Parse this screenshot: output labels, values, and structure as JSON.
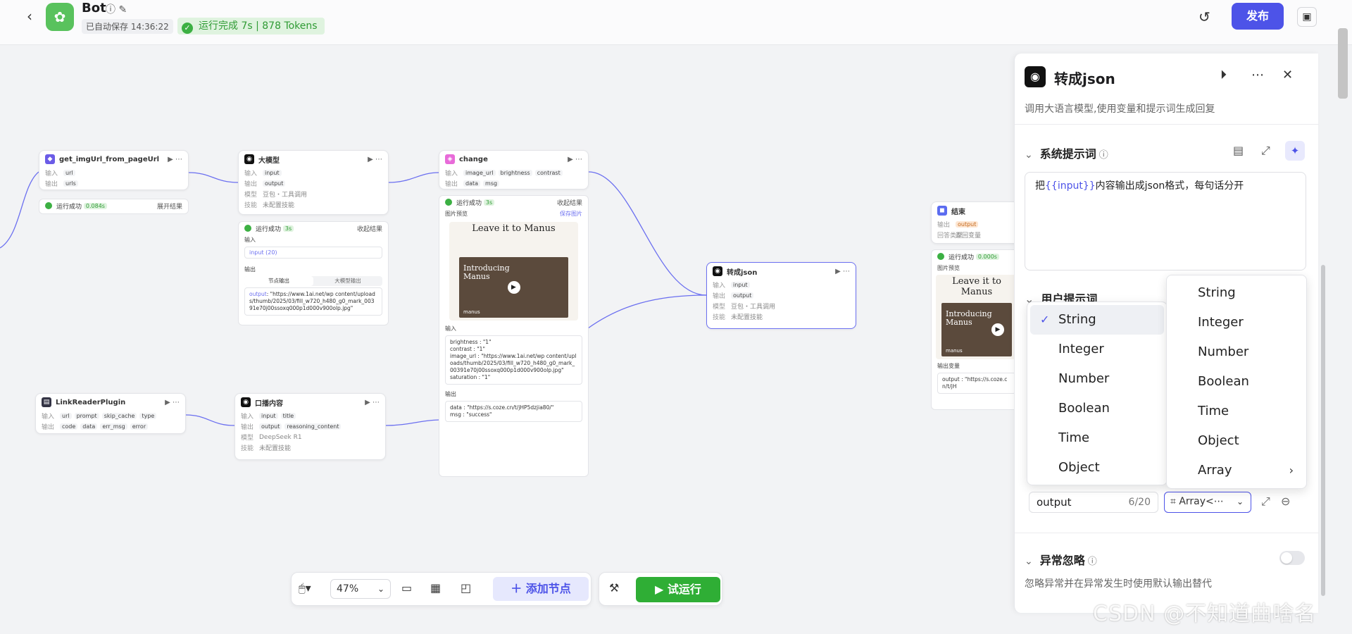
{
  "header": {
    "bot_name": "Bot",
    "autosave": "已自动保存 14:36:22",
    "run_status": "运行完成 7s | 878 Tokens",
    "publish_label": "发布"
  },
  "nodes": {
    "get_img": {
      "title": "get_imgUrl_from_pageUrl",
      "input_label": "输入",
      "input_var": "url",
      "output_label": "输出",
      "output_var": "urls",
      "status": "运行成功",
      "time": "0.084s",
      "expand": "展开结果"
    },
    "llm": {
      "title": "大模型",
      "input_label": "输入",
      "input_var": "input",
      "output_label": "输出",
      "output_var": "output",
      "model_label": "模型",
      "model": "豆包・工具调用",
      "skill_label": "技能",
      "skill": "未配置技能",
      "status": "运行成功",
      "time": "3s",
      "collapse": "收起结果",
      "in_label": "输入",
      "in_value": "input (20)",
      "out_label": "输出",
      "seg1": "节点输出",
      "seg2": "大模型输出",
      "out_key": "output",
      "out_value": ": \"https://www.1ai.net/wp content/uploads/thumb/2025/03/fill_w720_h480_g0_mark_00391e70j00ssoxq000p1d000v900olp.jpg\""
    },
    "change": {
      "title": "change",
      "input_label": "输入",
      "in1": "image_url",
      "in2": "brightness",
      "in3": "contrast",
      "output_label": "输出",
      "out1": "data",
      "out2": "msg",
      "status": "运行成功",
      "time": "3s",
      "collapse": "收起结果",
      "preview_label": "图片预览",
      "save_label": "保存图片",
      "img_title": "Leave it to Manus",
      "img_caption": "Introducing Manus",
      "img_brand": "manus",
      "in_label": "输入",
      "in_lines": [
        "brightness : \"1\"",
        "contrast : \"1\"",
        "image_url : \"https://www.1ai.net/wp content/uploads/thumb/2025/03/fill_w720_h480_g0_mark_00391e70j00ssoxq000p1d000v900olp.jpg\"",
        "saturation : \"1\""
      ],
      "out_label": "输出",
      "out_lines": [
        "data : \"https://s.coze.cn/t/jHP5dzjia80/\"",
        "msg : \"success\""
      ]
    },
    "to_json": {
      "title": "转成json",
      "input_label": "输入",
      "input_var": "input",
      "output_label": "输出",
      "output_var": "output",
      "model_label": "模型",
      "model": "豆包・工具调用",
      "skill_label": "技能",
      "skill": "未配置技能"
    },
    "end": {
      "title": "结束",
      "output_label": "输出",
      "output_var": "output",
      "return_label": "回答类型",
      "return": "返回变量",
      "status": "运行成功",
      "time": "0.000s",
      "preview_label": "图片预览",
      "img_title": "Leave it to Manus",
      "img_caption": "Introducing Manus",
      "img_brand": "manus",
      "outvar_label": "输出变量",
      "outvar_line": "output : \"https://s.coze.cn/t/jH"
    },
    "link_reader": {
      "title": "LinkReaderPlugin",
      "input_label": "输入",
      "in1": "url",
      "in2": "prompt",
      "in3": "skip_cache",
      "in4": "type",
      "output_label": "输出",
      "out1": "code",
      "out2": "data",
      "out3": "err_msg",
      "out4": "error"
    },
    "broadcast": {
      "title": "口播内容",
      "input_label": "输入",
      "in1": "input",
      "in2": "title",
      "output_label": "输出",
      "out1": "output",
      "out2": "reasoning_content",
      "model_label": "模型",
      "model": "DeepSeek R1",
      "skill_label": "技能",
      "skill": "未配置技能"
    }
  },
  "toolbar": {
    "zoom": "47%",
    "add_node": "添加节点",
    "try_run": "试运行"
  },
  "panel": {
    "title": "转成json",
    "description": "调用大语言模型,使用变量和提示词生成回复",
    "system_prompt_title": "系统提示词",
    "prompt_prefix": "把",
    "prompt_var": "{{input}}",
    "prompt_suffix": "内容输出成json格式，每句话分开",
    "user_prompt_title": "用户提示词",
    "output_name": "output",
    "output_count": "6/20",
    "output_type": "Array<⋯",
    "exception_title": "异常忽略",
    "exception_desc": "忽略异常并在异常发生时使用默认输出替代"
  },
  "dropdown_main": {
    "items": [
      "String",
      "Integer",
      "Number",
      "Boolean",
      "Time",
      "Object"
    ],
    "selected": "String"
  },
  "dropdown_side": {
    "items": [
      "String",
      "Integer",
      "Number",
      "Boolean",
      "Time",
      "Object",
      "Array"
    ]
  },
  "watermark": "CSDN @不知道曲啥名"
}
